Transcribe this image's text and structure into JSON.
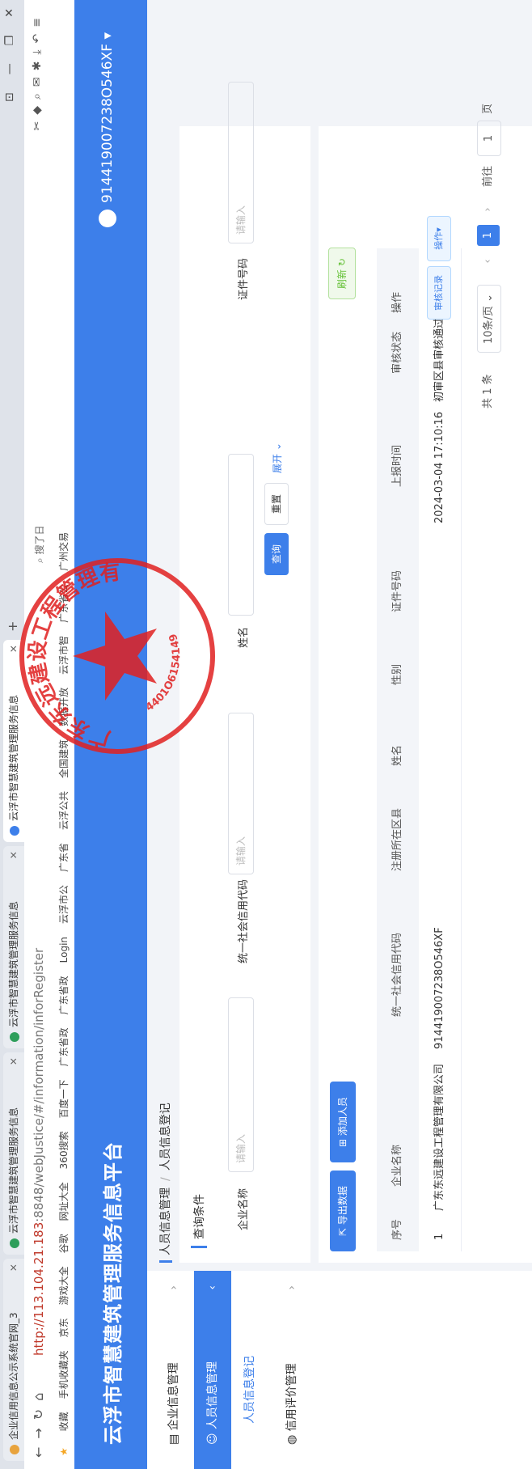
{
  "browser": {
    "tabs": [
      {
        "label": "企业信用信息公示系统官网_3",
        "color": "#e8a33d"
      },
      {
        "label": "云浮市智慧建筑管理服务信息",
        "color": "#2e9e5b"
      },
      {
        "label": "云浮市智慧建筑管理服务信息",
        "color": "#2e9e5b"
      },
      {
        "label": "云浮市智慧建筑管理服务信息",
        "color": "#3d7fea"
      }
    ],
    "url_prefix": "http://",
    "url_host": "113.104.21.183",
    "url_path": ":8848/webJustice/#/information/inforRegister",
    "bookmarks": [
      "收藏",
      "手机收藏夹",
      "京东",
      "游戏大全",
      "谷歌",
      "网址大全",
      "360搜索",
      "百度一下",
      "广东省政",
      "广东省政",
      "Login",
      "云浮市公",
      "广东省",
      "云浮公共",
      "全国建筑",
      "数据开放",
      "云浮市智",
      "广东省公",
      "广州交易"
    ],
    "search_hint": "搜了日"
  },
  "header": {
    "title": "云浮市智慧建筑管理服务信息平台",
    "user": "914419007238O546XF"
  },
  "sidebar": {
    "items": [
      {
        "label": "企业信息管理"
      },
      {
        "label": "人员信息管理"
      },
      {
        "label": "人员信息登记"
      },
      {
        "label": "信用评价管理"
      }
    ]
  },
  "breadcrumb": {
    "parent": "人员信息管理",
    "current": "人员信息登记"
  },
  "query": {
    "title": "查询条件",
    "fields": [
      {
        "label": "企业名称",
        "placeholder": "请输入"
      },
      {
        "label": "统一社会信用代码",
        "placeholder": "请输入"
      },
      {
        "label": "姓名",
        "placeholder": ""
      },
      {
        "label": "证件号码",
        "placeholder": "请输入"
      }
    ],
    "search": "查询",
    "reset": "重置",
    "expand": "展开"
  },
  "actions": {
    "export": "导出数据",
    "add": "添加人员",
    "refresh": "刷新"
  },
  "table": {
    "columns": [
      "序号",
      "企业名称",
      "统一社会信用代码",
      "注册所在区县",
      "姓名",
      "性别",
      "证件号码",
      "上报时间",
      "审核状态",
      "操作"
    ],
    "rows": [
      [
        "1",
        "广东东远建设工程管理有限公司",
        "914419007238O546XF",
        "",
        "",
        "",
        "",
        "2024-03-04 17:10:16",
        "初审区县审核通过",
        ""
      ]
    ],
    "row_actions": [
      "审核记录",
      "操作"
    ]
  },
  "pagination": {
    "total": "共 1 条",
    "size": "10条/页",
    "page": "1",
    "goto": "前往",
    "goto_value": "1",
    "unit": "页"
  },
  "stamp": {
    "text": "广东东远建设工程管理有限公司",
    "number": "4401O6154149",
    "color": "#e02020"
  }
}
